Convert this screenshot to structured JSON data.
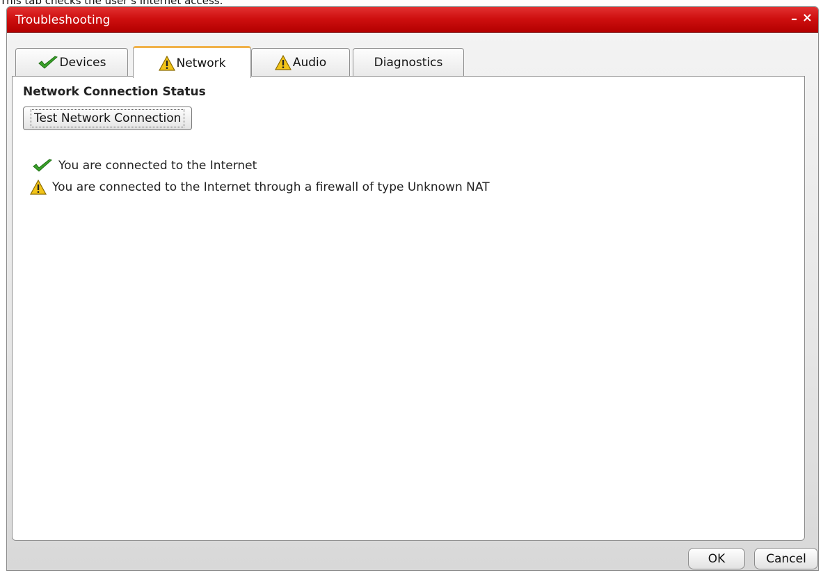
{
  "caption": "This tab checks the user’s Internet access.",
  "window": {
    "title": "Troubleshooting",
    "minimize_glyph": "–",
    "close_glyph": "×"
  },
  "tabs": [
    {
      "label": "Devices",
      "icon": "check-icon",
      "active": false
    },
    {
      "label": "Network",
      "icon": "warning-icon",
      "active": true
    },
    {
      "label": "Audio",
      "icon": "warning-icon",
      "active": false
    },
    {
      "label": "Diagnostics",
      "icon": "",
      "active": false
    }
  ],
  "network": {
    "heading": "Network Connection Status",
    "test_button_label": "Test Network Connection",
    "results": [
      {
        "icon": "check-icon",
        "text": "You are connected to the Internet"
      },
      {
        "icon": "warning-icon",
        "text": "You are connected to the Internet through a firewall of type Unknown NAT"
      }
    ]
  },
  "footer": {
    "ok_label": "OK",
    "cancel_label": "Cancel"
  },
  "colors": {
    "titlebar": "#cf1010",
    "active_tab_accent": "#f0b24a",
    "check_green": "#3aa12a",
    "warning_yellow": "#f2c418"
  }
}
